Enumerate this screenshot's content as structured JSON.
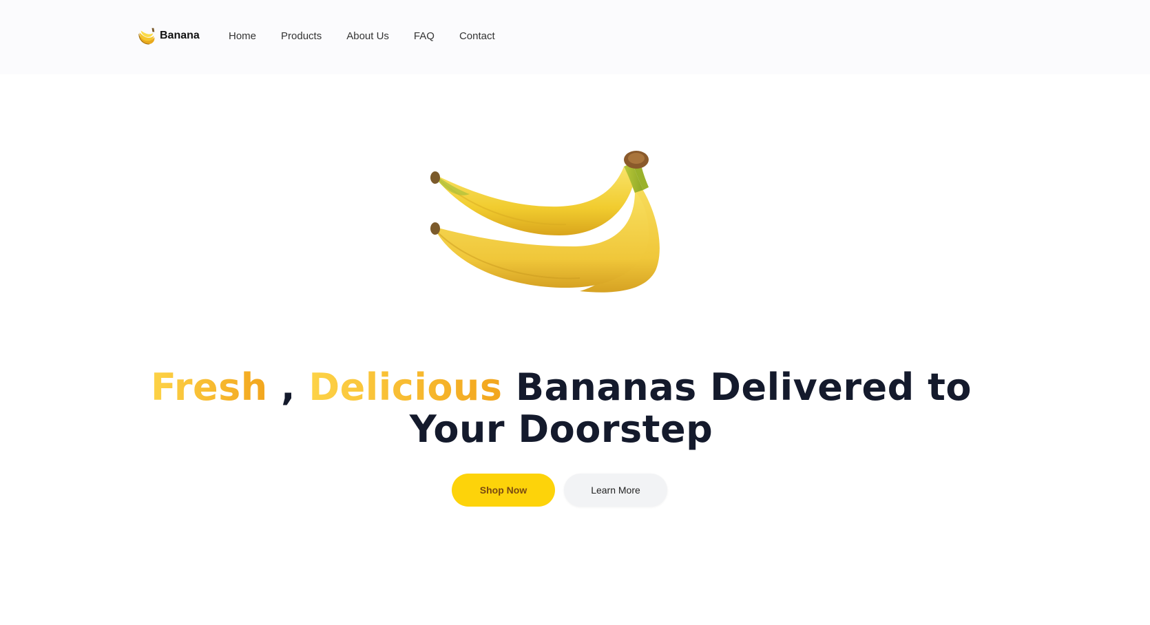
{
  "brand": {
    "name": "Banana",
    "icon": "banana-icon"
  },
  "nav": {
    "links": [
      "Home",
      "Products",
      "About Us",
      "FAQ",
      "Contact"
    ]
  },
  "hero": {
    "image": "banana-bunch",
    "title": {
      "highlight_1": "Fresh",
      "separator": " , ",
      "highlight_2": "Delicious",
      "rest": " Bananas Delivered to Your Doorstep"
    },
    "primary_button": "Shop Now",
    "secondary_button": "Learn More"
  },
  "colors": {
    "accent": "#fdd30a",
    "highlight_start": "#fdd347",
    "highlight_end": "#f2a51d",
    "heading": "#141a2c",
    "nav_background": "#fbfbfd"
  }
}
